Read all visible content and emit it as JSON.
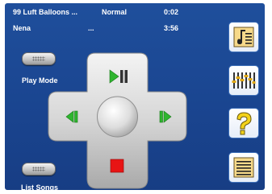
{
  "now_playing": {
    "title": "99 Luft Balloons ...",
    "artist": "Nena",
    "mode": "Normal",
    "extra": "...",
    "elapsed": "0:02",
    "duration": "3:56"
  },
  "left_buttons": {
    "play_mode_label": "Play Mode",
    "list_songs_label": "List Songs"
  },
  "controls": {
    "play_pause_icon": "play-pause-icon",
    "previous_icon": "previous-track-icon",
    "next_icon": "next-track-icon",
    "stop_icon": "stop-icon",
    "center_button": "center-select-button"
  },
  "side_buttons": [
    "music-note-list-icon",
    "equalizer-icon",
    "help-icon",
    "playlist-icon"
  ],
  "colors": {
    "background": "#1a4590",
    "play_green": "#2fb52f",
    "stop_red": "#e81414",
    "help_yellow": "#f3d21a",
    "button_border": "#3d6fb8"
  }
}
